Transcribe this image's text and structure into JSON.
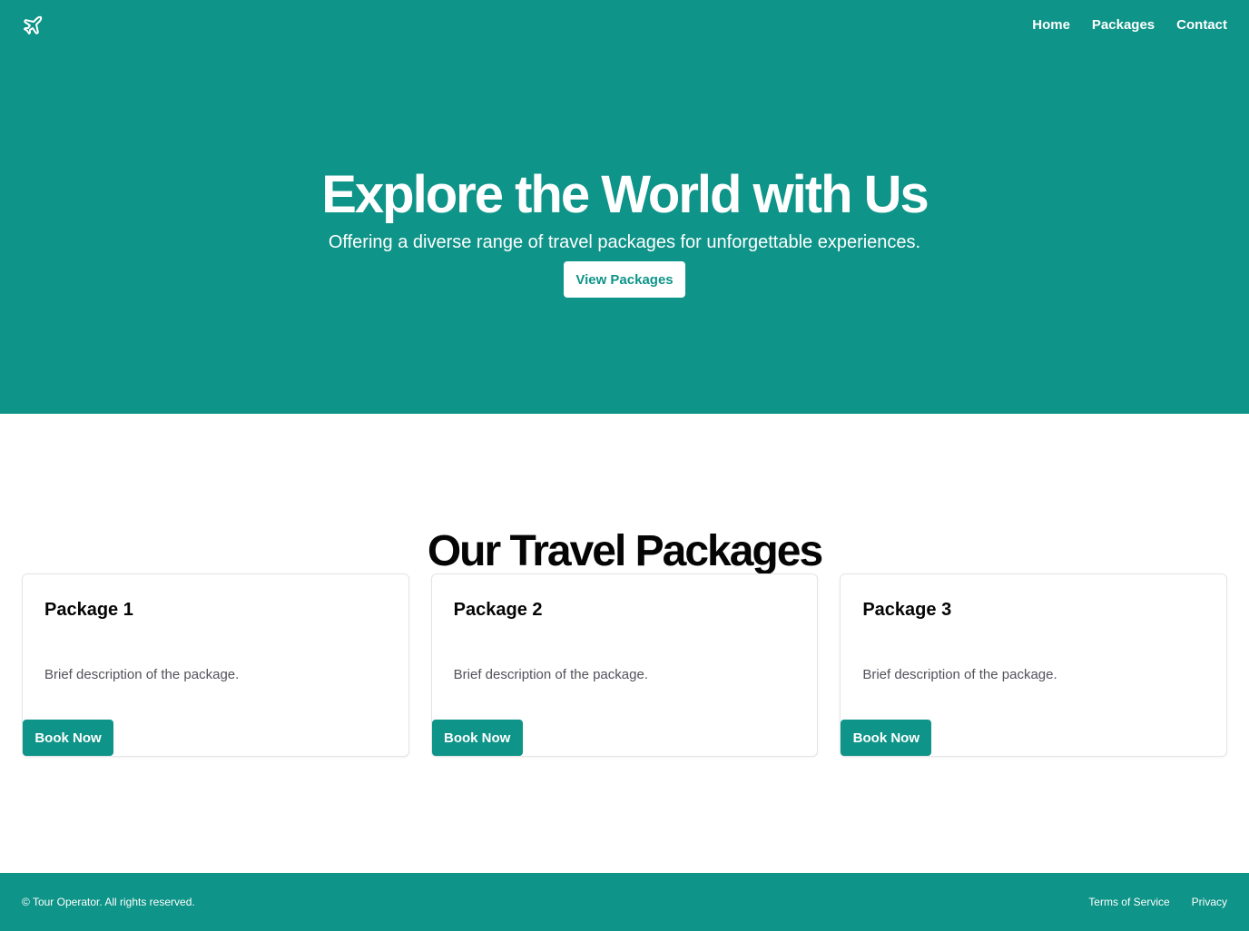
{
  "header": {
    "logo_icon": "plane-icon",
    "nav": [
      {
        "label": "Home"
      },
      {
        "label": "Packages"
      },
      {
        "label": "Contact"
      }
    ]
  },
  "hero": {
    "title": "Explore the World with Us",
    "subtitle": "Offering a diverse range of travel packages for unforgettable experiences.",
    "button_label": "View Packages"
  },
  "packages": {
    "title": "Our Travel Packages",
    "items": [
      {
        "title": "Package 1",
        "description": "Brief description of the package.",
        "button_label": "Book Now"
      },
      {
        "title": "Package 2",
        "description": "Brief description of the package.",
        "button_label": "Book Now"
      },
      {
        "title": "Package 3",
        "description": "Brief description of the package.",
        "button_label": "Book Now"
      }
    ]
  },
  "footer": {
    "copyright": "© Tour Operator. All rights reserved.",
    "links": [
      {
        "label": "Terms of Service"
      },
      {
        "label": "Privacy"
      }
    ]
  },
  "colors": {
    "brand": "#0e9488",
    "background": "#ffffff",
    "text": "#050505",
    "muted_text": "#52525b",
    "card_border": "#e4e4e7"
  }
}
